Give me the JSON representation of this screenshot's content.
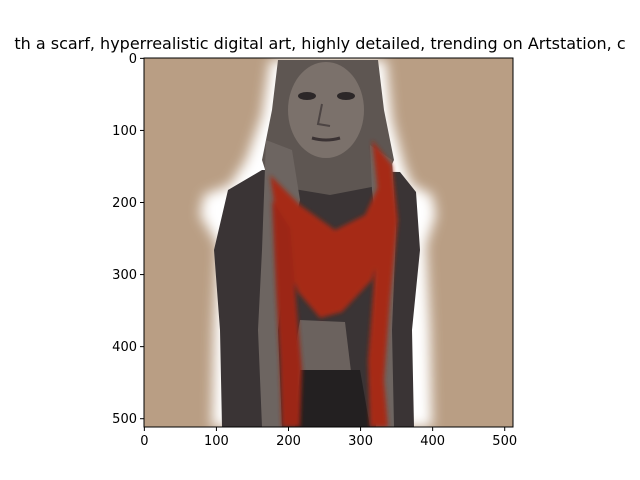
{
  "figure": {
    "title": "th a scarf,  hyperrealistic  digital art, highly detailed, trending on Artstation, c",
    "x_ticks": [
      "0",
      "100",
      "200",
      "300",
      "400",
      "500"
    ],
    "y_ticks": [
      "0",
      "100",
      "200",
      "300",
      "400",
      "500"
    ],
    "image": {
      "subject": "portrait of a woman wearing a hood and a red and gray scarf",
      "colors": {
        "background": "#b99e84",
        "skin": "#7b716b",
        "scarf_red": "#a62a18",
        "scarf_gray": "#5e5652",
        "glow": "#ffffff",
        "dark": "#232021"
      }
    }
  }
}
